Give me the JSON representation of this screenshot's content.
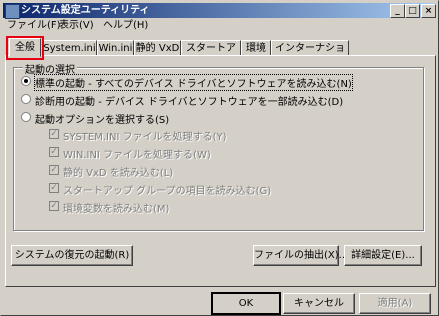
{
  "window": {
    "title": "システム設定ユーティリティ",
    "minimize": "_",
    "maximize": "□",
    "close": "×"
  },
  "menu": [
    "ファイル(F)",
    "表示(V)",
    "ヘルプ(H)"
  ],
  "tabs": [
    "全般",
    "System.ini",
    "Win.ini",
    "静的 VxD",
    "スタートアップ",
    "環境",
    "インターナショナル"
  ],
  "group": {
    "label": "起動の選択",
    "options": [
      "標準の起動 - すべてのデバイス ドライバとソフトウェアを読み込む(N)",
      "診断用の起動 - デバイス ドライバとソフトウェアを一部読み込む(D)",
      "起動オプションを選択する(S)"
    ],
    "selected_index": 0,
    "suboptions": [
      "SYSTEM.INI ファイルを処理する(Y)",
      "WIN.INI ファイルを処理する(W)",
      "静的 VxD を読み込む(L)",
      "スタートアップ グループの項目を読み込む(G)",
      "環境変数を読み込む(M)"
    ]
  },
  "buttons": {
    "restore": "システムの復元の起動(R)",
    "extract": "ファイルの抽出(X)...",
    "advanced": "詳細設定(E)...",
    "ok": "OK",
    "cancel": "キャンセル",
    "apply": "適用(A)"
  }
}
